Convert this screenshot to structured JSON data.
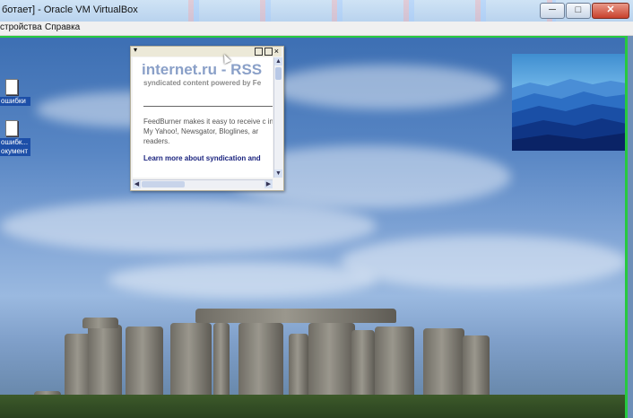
{
  "window": {
    "title": "ботает] - Oracle VM VirtualBox",
    "minimize_glyph": "─",
    "maximize_glyph": "□",
    "close_glyph": "✕"
  },
  "menubar": {
    "items": [
      "стройства",
      "Справка"
    ]
  },
  "desktop": {
    "icons": [
      {
        "label": "ошибки"
      },
      {
        "label": "ошибк...\nокумент"
      }
    ]
  },
  "feed_gadget": {
    "menu_glyph": "▾",
    "close_glyph": "×",
    "headline": "internet.ru - RSS",
    "subtitle": "syndicated content powered by Fe",
    "body": "FeedBurner makes it easy to receive c in My Yahoo!, Newsgator, Bloglines, ar readers.",
    "link": "Learn more about syndication and",
    "scroll_up": "▲",
    "scroll_down": "▼",
    "scroll_left": "◀",
    "scroll_right": "▶"
  },
  "colors": {
    "accent_green": "#27c93f",
    "link": "#1a237e",
    "headline": "#8aa0c8",
    "icon_label_bg": "#1d4fa8"
  }
}
